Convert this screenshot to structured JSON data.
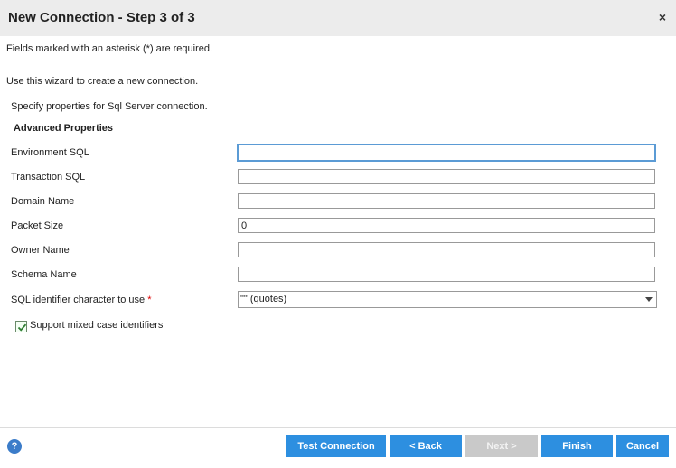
{
  "dialog": {
    "title": "New Connection - Step 3 of 3",
    "close_label": "×"
  },
  "notes": {
    "required": "Fields marked with an asterisk (*) are required.",
    "wizard": "Use this wizard to create a new connection.",
    "specify": "Specify properties for Sql Server connection."
  },
  "section": {
    "heading": "Advanced Properties"
  },
  "fields": {
    "environment_sql": {
      "label": "Environment SQL",
      "value": ""
    },
    "transaction_sql": {
      "label": "Transaction SQL",
      "value": ""
    },
    "domain_name": {
      "label": "Domain Name",
      "value": ""
    },
    "packet_size": {
      "label": "Packet Size",
      "value": "0"
    },
    "owner_name": {
      "label": "Owner Name",
      "value": ""
    },
    "schema_name": {
      "label": "Schema Name",
      "value": ""
    },
    "sql_identifier": {
      "label": "SQL identifier character to use",
      "required_mark": "*",
      "selected": "\"\" (quotes)"
    }
  },
  "checkbox": {
    "label": "Support mixed case identifiers",
    "checked": true
  },
  "footer": {
    "help_icon": "?",
    "buttons": {
      "test_connection": "Test Connection",
      "back": "< Back",
      "next": "Next >",
      "finish": "Finish",
      "cancel": "Cancel"
    }
  },
  "colors": {
    "accent": "#2d8fe0",
    "disabled": "#c9c9c9",
    "focus": "#5b9bd5",
    "required": "#dd0000"
  }
}
